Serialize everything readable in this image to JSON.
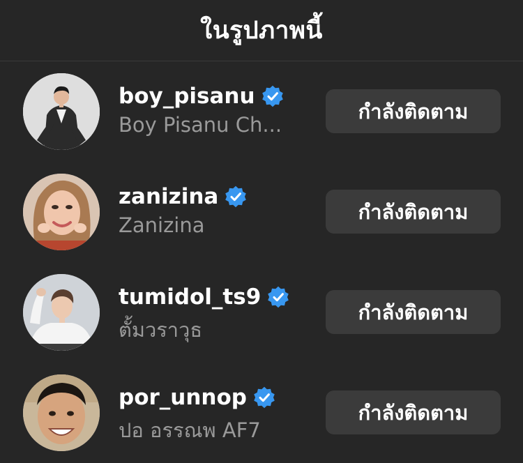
{
  "header": {
    "title": "ในรูปภาพนี้"
  },
  "colors": {
    "background": "#262626",
    "button_bg": "#3b3b3b",
    "verified_blue": "#3897f0",
    "secondary_text": "#9a9a9a"
  },
  "users": [
    {
      "username": "boy_pisanu",
      "fullname": "Boy Pisanu Ch...",
      "verified": true,
      "button_label": "กำลังติดตาม"
    },
    {
      "username": "zanizina",
      "fullname": "Zanizina",
      "verified": true,
      "button_label": "กำลังติดตาม"
    },
    {
      "username": "tumidol_ts9",
      "fullname": "ตั้มวราวุธ",
      "verified": true,
      "button_label": "กำลังติดตาม"
    },
    {
      "username": "por_unnop",
      "fullname": "ปอ อรรณพ AF7",
      "verified": true,
      "button_label": "กำลังติดตาม"
    }
  ]
}
